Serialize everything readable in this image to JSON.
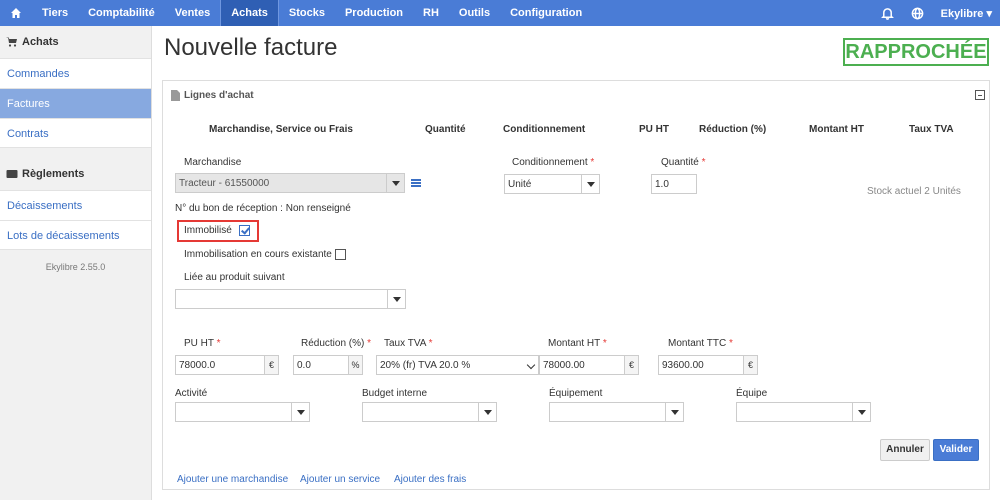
{
  "nav": {
    "items": [
      "Tiers",
      "Comptabilité",
      "Ventes",
      "Achats",
      "Stocks",
      "Production",
      "RH",
      "Outils",
      "Configuration"
    ],
    "active": "Achats",
    "user": "Ekylibre"
  },
  "sidebar": {
    "section1": "Achats",
    "items1": [
      "Commandes",
      "Factures",
      "Contrats"
    ],
    "active": "Factures",
    "section2": "Règlements",
    "items2": [
      "Décaissements",
      "Lots de décaissements"
    ],
    "version": "Ekylibre 2.55.0"
  },
  "page": {
    "title": "Nouvelle facture",
    "status": "RAPPROCHÉE"
  },
  "panel": {
    "heading": "Lignes d'achat",
    "columns": [
      "Marchandise, Service ou Frais",
      "Quantité",
      "Conditionnement",
      "PU HT",
      "Réduction (%)",
      "Montant HT",
      "Taux TVA"
    ]
  },
  "form": {
    "marchandise_label": "Marchandise",
    "marchandise_value": "Tracteur - 61550000",
    "conditionnement_label": "Conditionnement",
    "conditionnement_value": "Unité",
    "quantite_label": "Quantité",
    "quantite_value": "1.0",
    "stock": "Stock actuel 2 Unités",
    "reception": "N° du bon de réception : Non renseigné",
    "immobilise_label": "Immobilisé",
    "immobilisation_label": "Immobilisation en cours existante",
    "lie_label": "Liée au produit suivant",
    "pu_label": "PU HT",
    "pu_value": "78000.0",
    "reduction_label": "Réduction (%)",
    "reduction_value": "0.0",
    "tva_label": "Taux TVA",
    "tva_value": "20% (fr) TVA 20.0 %",
    "montant_ht_label": "Montant HT",
    "montant_ht_value": "78000.00",
    "montant_ttc_label": "Montant TTC",
    "montant_ttc_value": "93600.00",
    "currency": "€",
    "percent": "%",
    "activite_label": "Activité",
    "budget_label": "Budget interne",
    "equipement_label": "Équipement",
    "equipe_label": "Équipe",
    "required_mark": "*"
  },
  "actions": {
    "cancel": "Annuler",
    "submit": "Valider",
    "add_merch": "Ajouter une marchandise",
    "add_service": "Ajouter un service",
    "add_fees": "Ajouter des frais"
  }
}
